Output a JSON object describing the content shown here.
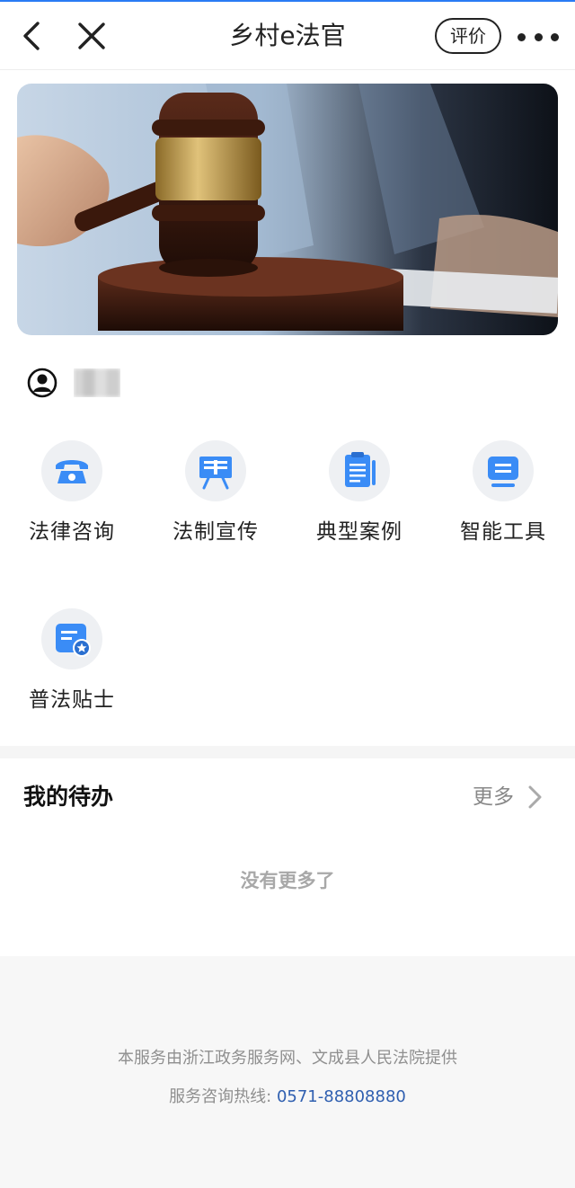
{
  "header": {
    "title": "乡村e法官",
    "rate_label": "评价",
    "icons": {
      "back": "chevron-left-icon",
      "close": "close-icon",
      "more": "more-dots-icon"
    }
  },
  "banner": {
    "image": "judge-gavel-photo"
  },
  "user": {
    "avatar_icon": "user-circle-icon",
    "name": ""
  },
  "services": [
    {
      "label": "法律咨询",
      "icon": "telephone-icon"
    },
    {
      "label": "法制宣传",
      "icon": "easel-board-icon"
    },
    {
      "label": "典型案例",
      "icon": "document-list-icon"
    },
    {
      "label": "智能工具",
      "icon": "monitor-icon"
    },
    {
      "label": "普法贴士",
      "icon": "card-star-icon"
    }
  ],
  "todo": {
    "title": "我的待办",
    "more_label": "更多",
    "empty_text": "没有更多了"
  },
  "footer": {
    "line1": "本服务由浙江政务服务网、文成县人民法院提供",
    "hotline_label": "服务咨询热线:",
    "hotline_number": "0571-88808880"
  },
  "colors": {
    "accent": "#2a7bf4",
    "icon_blue": "#3a8cf6",
    "link_blue": "#2f5fb0",
    "muted_text": "#8f8f8f",
    "footer_bg": "#f7f7f7"
  }
}
